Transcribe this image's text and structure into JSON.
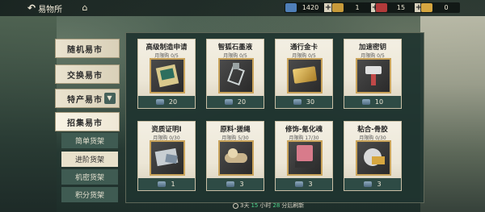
{
  "topbar": {
    "back_label": "易物所",
    "resources": [
      {
        "icon": "gem-icon",
        "value": "1420",
        "color": "#4f7fb8"
      },
      {
        "icon": "ticket-icon",
        "value": "1",
        "color": "#c79a3a"
      },
      {
        "icon": "ticket-red-icon",
        "value": "15",
        "color": "#b23a3a"
      },
      {
        "icon": "gold-ticket-icon",
        "value": "0",
        "color": "#d6a640"
      }
    ]
  },
  "sidebar": {
    "tabs": [
      {
        "label": "随机易市"
      },
      {
        "label": "交换易市"
      },
      {
        "label": "特产易市"
      },
      {
        "label": "招集易市"
      }
    ],
    "subtabs": [
      {
        "label": "简单货架"
      },
      {
        "label": "进阶货架"
      },
      {
        "label": "机密货架"
      },
      {
        "label": "积分货架"
      }
    ]
  },
  "items": [
    {
      "name": "高级制造申请",
      "limit": "月限购 0/5",
      "price": "20",
      "icon": "envelope-document-icon"
    },
    {
      "name": "智狐石墨液",
      "limit": "月限购 0/5",
      "price": "20",
      "icon": "glass-bottle-icon"
    },
    {
      "name": "通行金卡",
      "limit": "月限购 0/5",
      "price": "30",
      "icon": "gold-card-icon"
    },
    {
      "name": "加速密钥",
      "limit": "月限购 0/5",
      "price": "10",
      "icon": "key-usb-icon"
    },
    {
      "name": "资质证明Ⅰ",
      "limit": "月限购 0/30",
      "price": "1",
      "icon": "certificate-card-icon"
    },
    {
      "name": "原料·搓绳",
      "limit": "月限购 5/30",
      "price": "3",
      "icon": "rope-bundle-icon"
    },
    {
      "name": "修饰-氪化魂",
      "limit": "月限购 17/30",
      "price": "3",
      "icon": "device-box-icon"
    },
    {
      "name": "粘合-骨胶",
      "limit": "月限购 0/30",
      "price": "3",
      "icon": "glue-can-icon"
    }
  ],
  "refresh": {
    "prefix": "3天",
    "hours": "15",
    "mid": "小时",
    "minutes": "28",
    "suffix": "分后刷新"
  }
}
